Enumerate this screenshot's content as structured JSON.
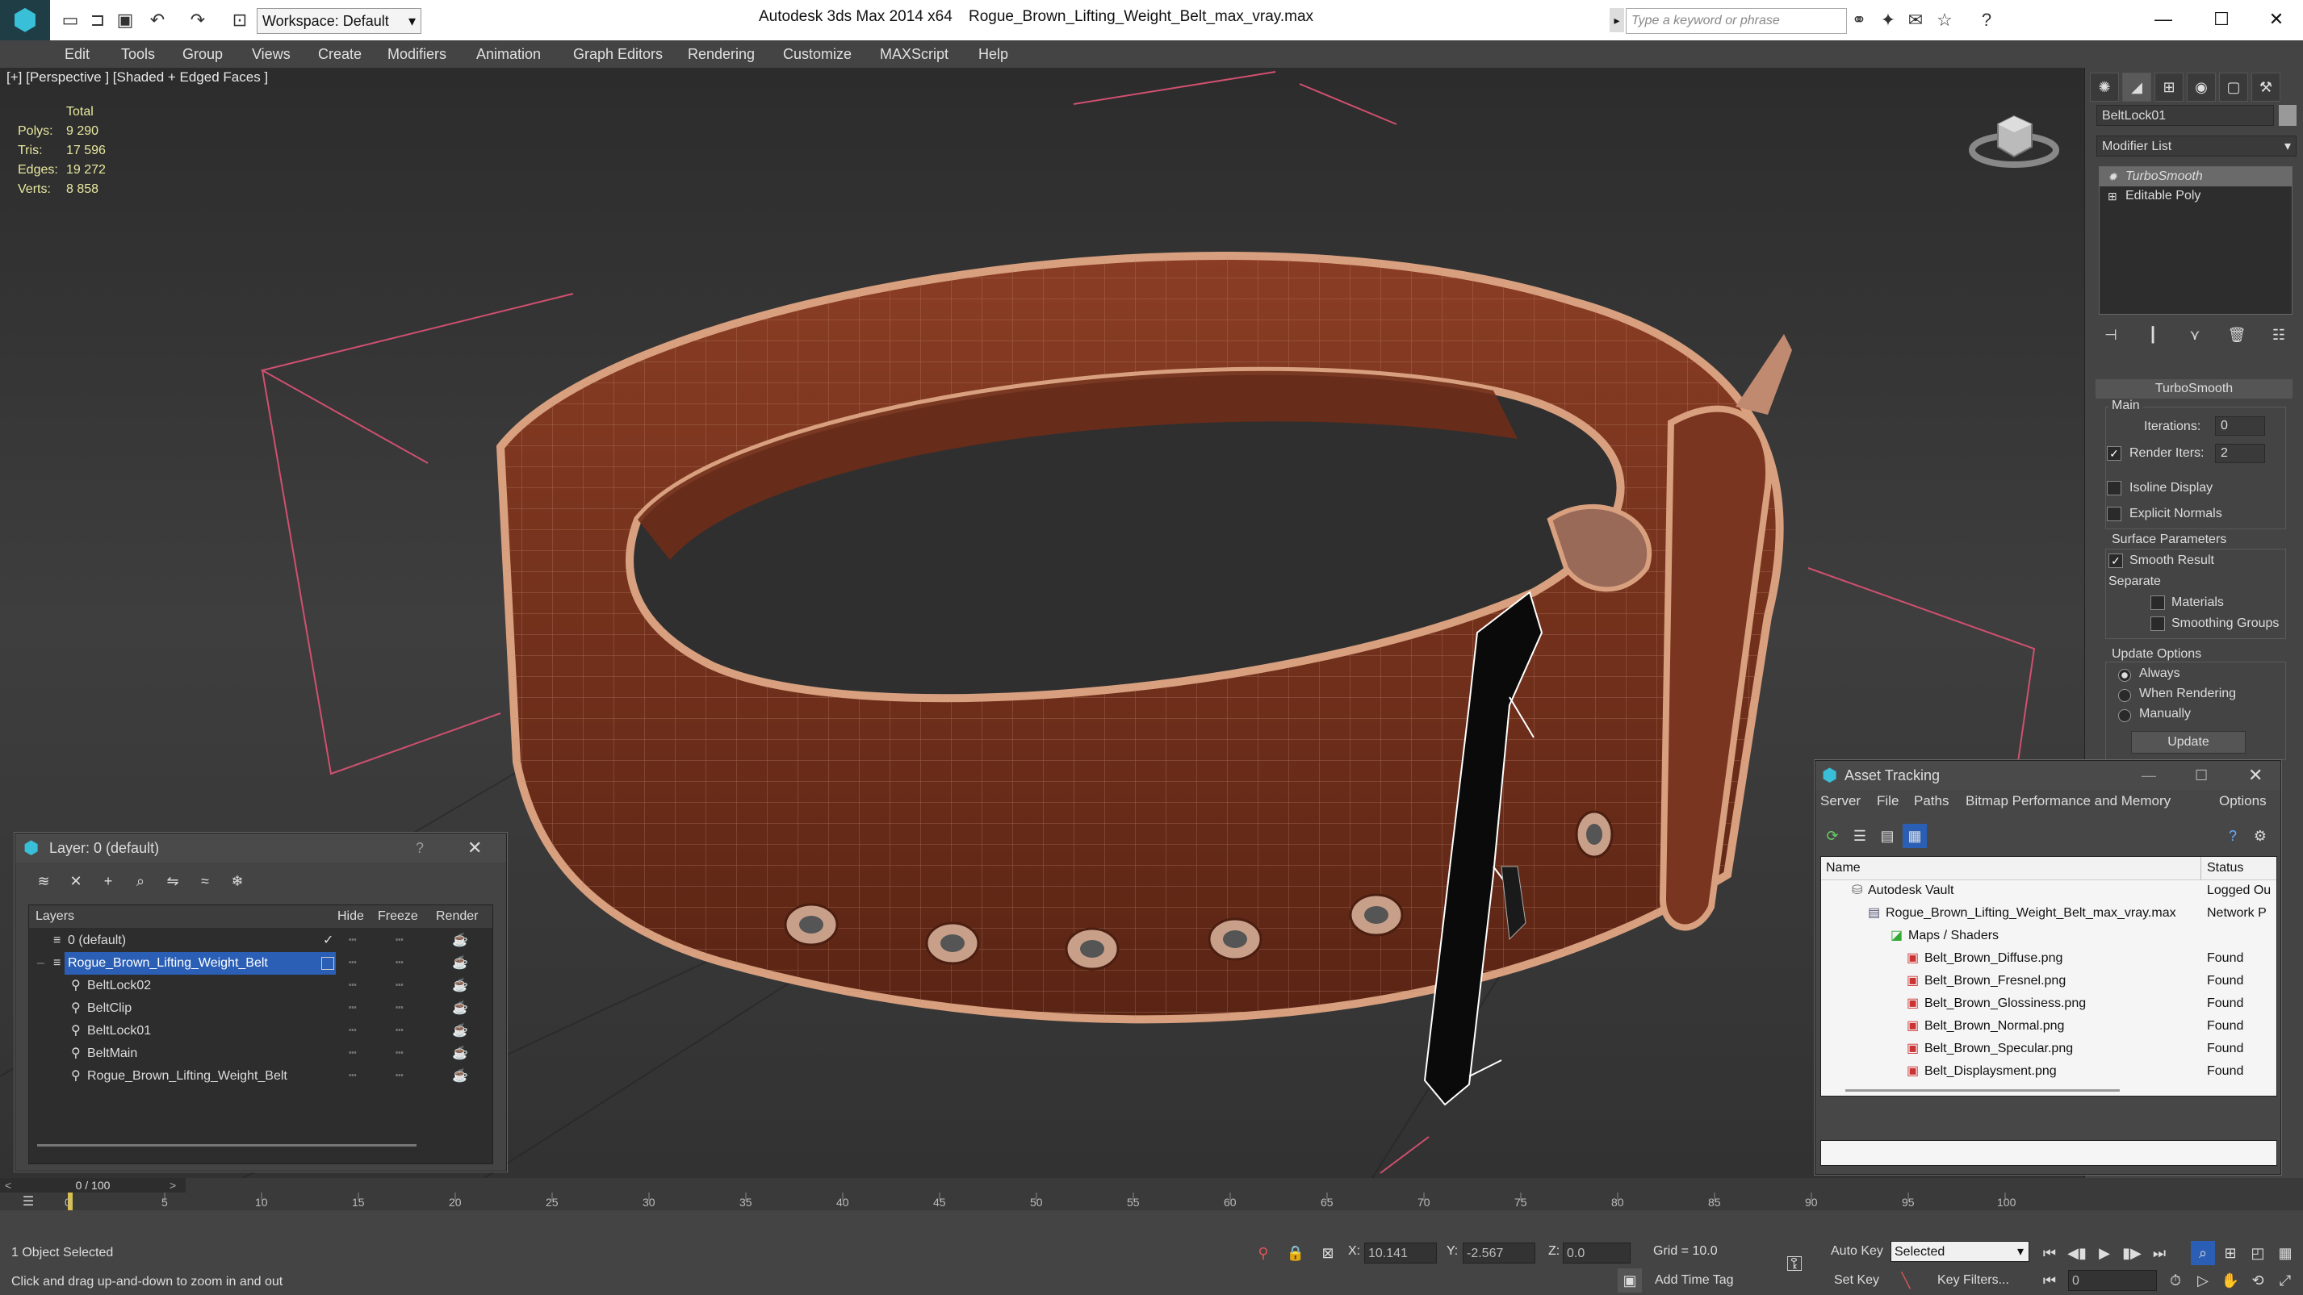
{
  "app": {
    "title": "Autodesk 3ds Max  2014 x64",
    "file": "Rogue_Brown_Lifting_Weight_Belt_max_vray.max",
    "workspace": "Workspace: Default",
    "search_placeholder": "Type a keyword or phrase"
  },
  "menu": [
    "Edit",
    "Tools",
    "Group",
    "Views",
    "Create",
    "Modifiers",
    "Animation",
    "Graph Editors",
    "Rendering",
    "Customize",
    "MAXScript",
    "Help"
  ],
  "viewport": {
    "label": "[+] [Perspective ] [Shaded + Edged Faces ]",
    "stats": {
      "header": "Total",
      "polys_label": "Polys:",
      "polys": "9 290",
      "tris_label": "Tris:",
      "tris": "17 596",
      "edges_label": "Edges:",
      "edges": "19 272",
      "verts_label": "Verts:",
      "verts": "8 858"
    }
  },
  "command_panel": {
    "object_name": "BeltLock01",
    "modifier_list": "Modifier List",
    "stack": [
      "TurboSmooth",
      "Editable Poly"
    ],
    "turbosmooth": {
      "header": "TurboSmooth",
      "main": "Main",
      "iterations_label": "Iterations:",
      "iterations": "0",
      "render_iters_label": "Render Iters:",
      "render_iters": "2",
      "isoline": "Isoline Display",
      "explicit_normals": "Explicit Normals",
      "surface_params": "Surface Parameters",
      "smooth_result": "Smooth Result",
      "separate": "Separate",
      "materials": "Materials",
      "smoothing_groups": "Smoothing Groups",
      "update_options": "Update Options",
      "always": "Always",
      "when_rendering": "When Rendering",
      "manually": "Manually",
      "update_btn": "Update"
    }
  },
  "layer_panel": {
    "title": "Layer: 0 (default)",
    "help": "?",
    "columns": {
      "layers": "Layers",
      "hide": "Hide",
      "freeze": "Freeze",
      "render": "Render"
    },
    "rows": [
      "0 (default)",
      "Rogue_Brown_Lifting_Weight_Belt",
      "BeltLock02",
      "BeltClip",
      "BeltLock01",
      "BeltMain",
      "Rogue_Brown_Lifting_Weight_Belt"
    ]
  },
  "asset_panel": {
    "title": "Asset Tracking",
    "menu": [
      "Server",
      "File",
      "Paths",
      "Bitmap Performance and Memory",
      "Options"
    ],
    "columns": {
      "name": "Name",
      "status": "Status"
    },
    "rows": [
      {
        "name": "Autodesk Vault",
        "status": "Logged Ou"
      },
      {
        "name": "Rogue_Brown_Lifting_Weight_Belt_max_vray.max",
        "status": "Network P"
      },
      {
        "name": "Maps / Shaders",
        "status": ""
      },
      {
        "name": "Belt_Brown_Diffuse.png",
        "status": "Found"
      },
      {
        "name": "Belt_Brown_Fresnel.png",
        "status": "Found"
      },
      {
        "name": "Belt_Brown_Glossiness.png",
        "status": "Found"
      },
      {
        "name": "Belt_Brown_Normal.png",
        "status": "Found"
      },
      {
        "name": "Belt_Brown_Specular.png",
        "status": "Found"
      },
      {
        "name": "Belt_Displaysment.png",
        "status": "Found"
      }
    ]
  },
  "timeline": {
    "frame": "0 / 100",
    "ticks": [
      "0",
      "5",
      "10",
      "15",
      "20",
      "25",
      "30",
      "35",
      "40",
      "45",
      "50",
      "55",
      "60",
      "65",
      "70",
      "75",
      "80",
      "85",
      "90",
      "95",
      "100"
    ]
  },
  "statusbar": {
    "selected": "1 Object Selected",
    "hint": "Click and drag up-and-down to zoom in and out",
    "x_label": "X:",
    "x": "10.141",
    "y_label": "Y:",
    "y": "-2.567",
    "z_label": "Z:",
    "z": "0.0",
    "grid": "Grid = 10.0",
    "add_time_tag": "Add Time Tag",
    "auto_key": "Auto Key",
    "set_key": "Set Key",
    "selected_dropdown": "Selected",
    "key_filters": "Key Filters...",
    "current_frame": "0"
  },
  "colors": {
    "belt": "#7a3520",
    "selection": "#2a5fb5",
    "accent": "#e8e8a0"
  }
}
